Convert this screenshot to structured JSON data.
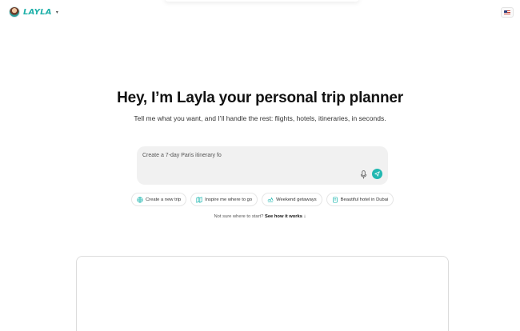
{
  "header": {
    "brand": "LAYLA",
    "caret": "▾"
  },
  "hero": {
    "headline": "Hey, I’m Layla your personal trip planner",
    "subline": "Tell me what you want, and I’ll handle the rest: flights, hotels, itineraries, in seconds."
  },
  "prompt": {
    "text": "Create a 7-day Paris itinerary fo"
  },
  "chips": [
    {
      "label": "Create a new trip",
      "icon": "globe-icon"
    },
    {
      "label": "Inspire me where to go",
      "icon": "map-icon"
    },
    {
      "label": "Weekend getaways",
      "icon": "plane-icon"
    },
    {
      "label": "Beautiful hotel in Dubai",
      "icon": "hotel-icon"
    }
  ],
  "hint": {
    "prefix": "Not sure where to start?",
    "link": "See how it works ↓"
  },
  "colors": {
    "accent": "#22b8b1",
    "brand": "#1fb0a9"
  }
}
